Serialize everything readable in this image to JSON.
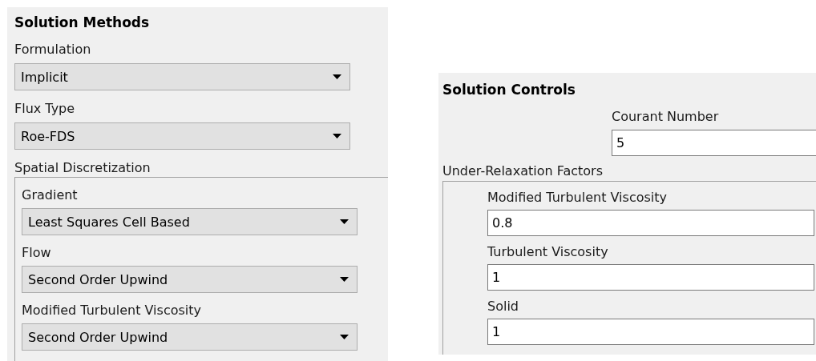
{
  "solution_methods": {
    "title": "Solution Methods",
    "fields": [
      {
        "label": "Formulation",
        "value": "Implicit"
      },
      {
        "label": "Flux Type",
        "value": "Roe-FDS"
      }
    ],
    "spatial_discretization": {
      "label": "Spatial Discretization",
      "items": [
        {
          "label": "Gradient",
          "value": "Least Squares Cell Based"
        },
        {
          "label": "Flow",
          "value": "Second Order Upwind"
        },
        {
          "label": "Modified Turbulent Viscosity",
          "value": "Second Order Upwind"
        }
      ]
    }
  },
  "solution_controls": {
    "title": "Solution Controls",
    "courant_number": {
      "label": "Courant Number",
      "value": "5"
    },
    "under_relaxation_factors": {
      "label": "Under-Relaxation Factors",
      "items": [
        {
          "label": "Modified Turbulent Viscosity",
          "value": "0.8"
        },
        {
          "label": "Turbulent Viscosity",
          "value": "1"
        },
        {
          "label": "Solid",
          "value": "1"
        }
      ]
    }
  }
}
